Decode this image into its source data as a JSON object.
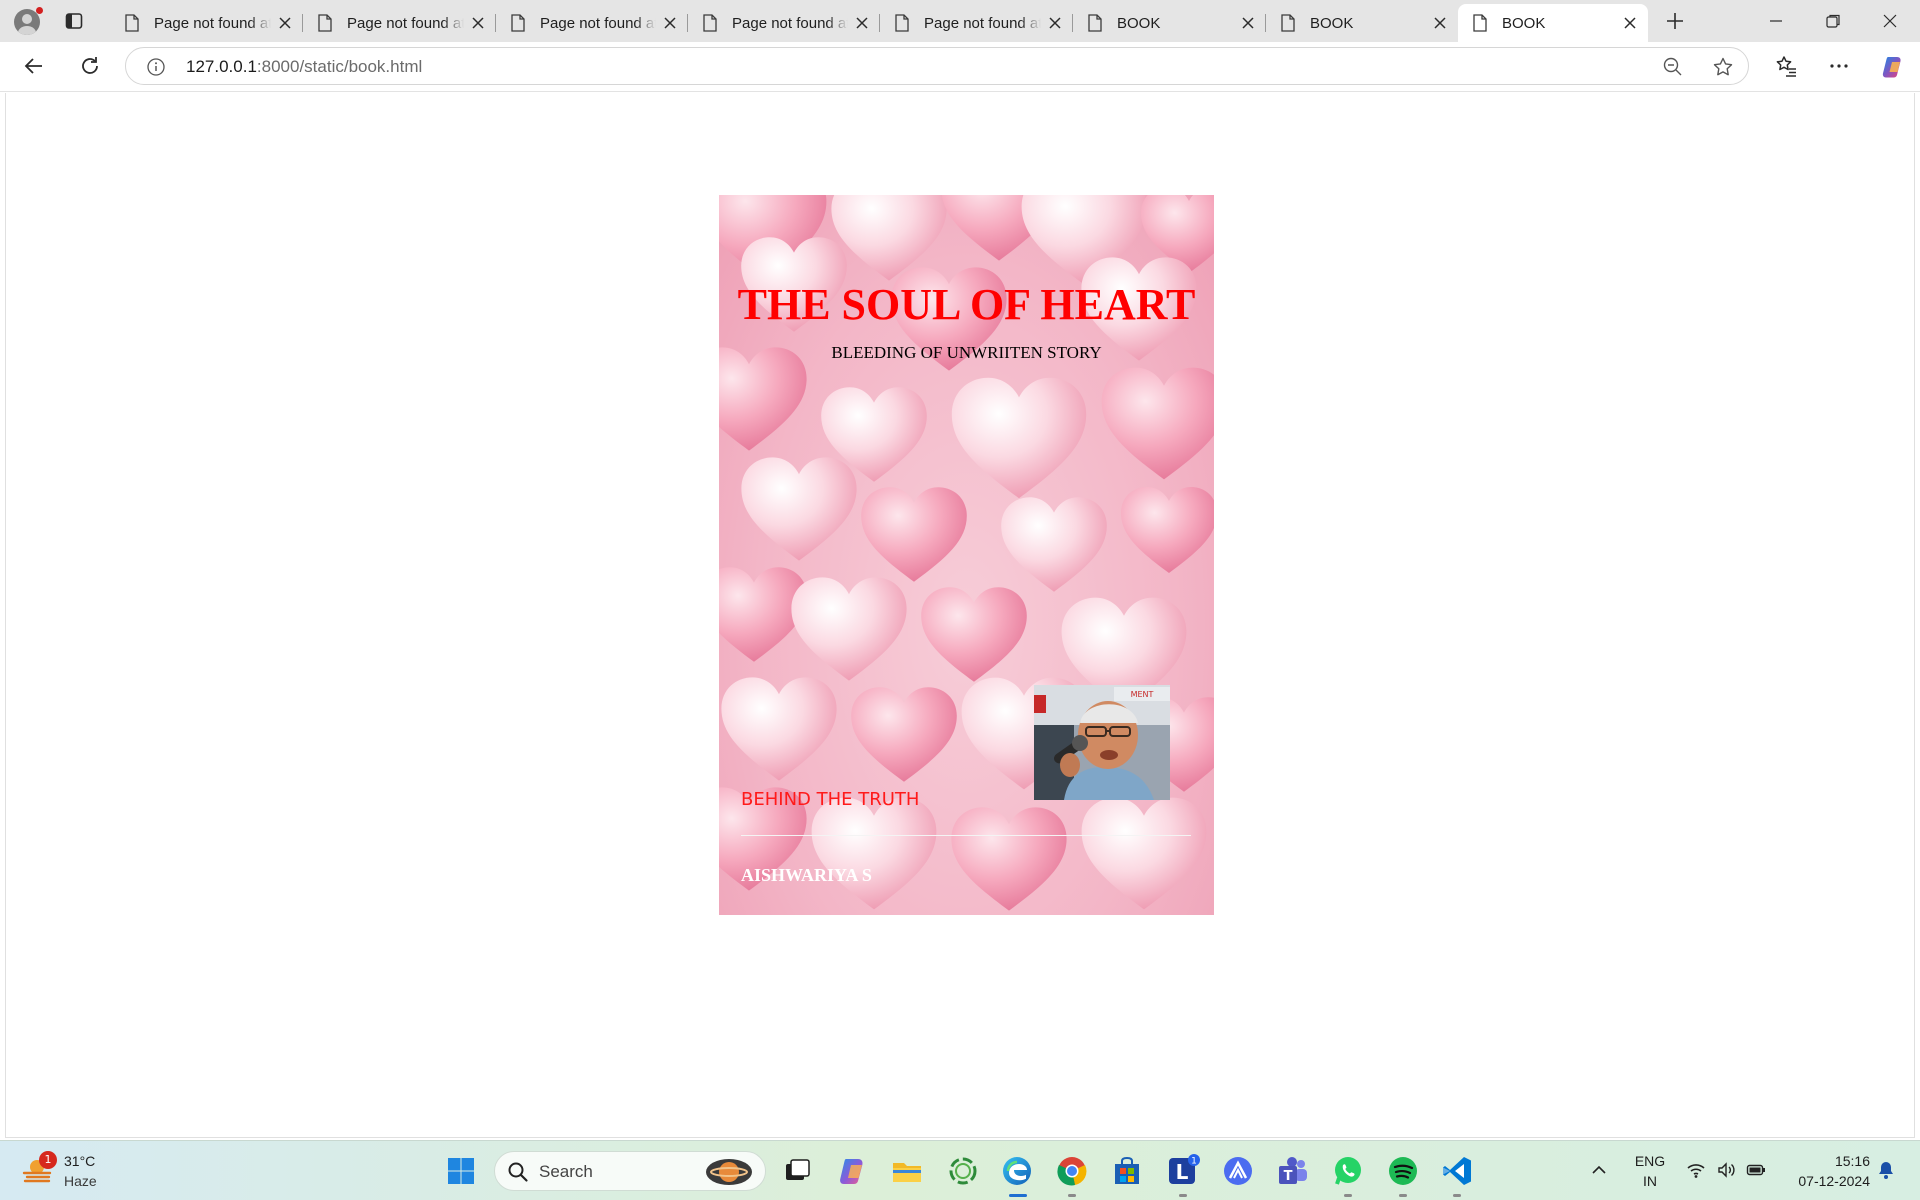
{
  "browser": {
    "tabs": [
      {
        "title": "Page not found at /static/book.html",
        "active": false
      },
      {
        "title": "Page not found at /static/book.html",
        "active": false
      },
      {
        "title": "Page not found at /static/book.html",
        "active": false
      },
      {
        "title": "Page not found at /static/book.html",
        "active": false
      },
      {
        "title": "Page not found at /static/book.html",
        "active": false
      },
      {
        "title": "BOOK",
        "active": false
      },
      {
        "title": "BOOK",
        "active": false
      },
      {
        "title": "BOOK",
        "active": true
      }
    ],
    "address": {
      "host": "127.0.0.1",
      "path": ":8000/static/book.html"
    }
  },
  "book": {
    "title": "THE SOUL OF HEART",
    "subtitle": "BLEEDING OF UNWRIITEN STORY",
    "tagline": "BEHIND THE TRUTH",
    "author": "AISHWARIYA S",
    "colors": {
      "title": "#ff0000",
      "tagline": "#ff1a1a",
      "author": "#ffffff",
      "cover_background": "#f3b6c7"
    }
  },
  "taskbar": {
    "weather": {
      "temperature": "31°C",
      "condition": "Haze",
      "badge": "1"
    },
    "search_placeholder": "Search",
    "apps": [
      "start-icon",
      "task-view-icon",
      "copilot-icon",
      "file-explorer-icon",
      "refresh-app-icon",
      "edge-icon",
      "chrome-icon",
      "store-icon",
      "l-app-icon",
      "arc-app-icon",
      "teams-icon",
      "whatsapp-icon",
      "spotify-icon",
      "vscode-icon"
    ],
    "l_app_badge": "1",
    "language": {
      "line1": "ENG",
      "line2": "IN"
    },
    "time": "15:16",
    "date": "07-12-2024"
  }
}
